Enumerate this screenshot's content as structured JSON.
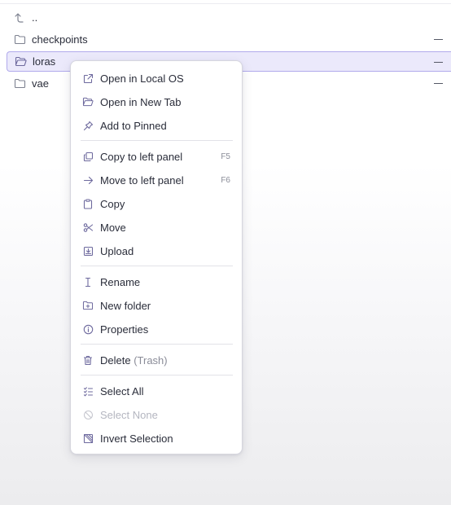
{
  "colors": {
    "accent": "#6a5fd0",
    "selection_bg": "#ebe9fb",
    "selection_border": "#b1aaec",
    "icon": "#6e6a9e"
  },
  "file_list": {
    "items": [
      {
        "name": "..",
        "icon": "level-up-icon",
        "selected": false
      },
      {
        "name": "checkpoints",
        "icon": "folder-icon",
        "selected": false
      },
      {
        "name": "loras",
        "icon": "folder-open-icon",
        "selected": true
      },
      {
        "name": "vae",
        "icon": "folder-icon",
        "selected": false
      }
    ]
  },
  "context_menu": {
    "groups": [
      [
        {
          "label": "Open in Local OS",
          "icon": "external-link-icon"
        },
        {
          "label": "Open in New Tab",
          "icon": "folder-open-icon"
        },
        {
          "label": "Add to Pinned",
          "icon": "pin-icon"
        }
      ],
      [
        {
          "label": "Copy to left panel",
          "icon": "copy-panel-icon",
          "shortcut": "F5"
        },
        {
          "label": "Move to left panel",
          "icon": "arrow-right-icon",
          "shortcut": "F6"
        },
        {
          "label": "Copy",
          "icon": "clipboard-icon"
        },
        {
          "label": "Move",
          "icon": "scissors-icon"
        },
        {
          "label": "Upload",
          "icon": "upload-icon"
        }
      ],
      [
        {
          "label": "Rename",
          "icon": "text-cursor-icon"
        },
        {
          "label": "New folder",
          "icon": "folder-plus-icon"
        },
        {
          "label": "Properties",
          "icon": "info-icon"
        }
      ],
      [
        {
          "label": "Delete",
          "label_suffix": "(Trash)",
          "icon": "trash-icon"
        }
      ],
      [
        {
          "label": "Select All",
          "icon": "list-check-icon"
        },
        {
          "label": "Select None",
          "icon": "ban-icon",
          "disabled": true
        },
        {
          "label": "Invert Selection",
          "icon": "invert-selection-icon"
        }
      ]
    ]
  }
}
